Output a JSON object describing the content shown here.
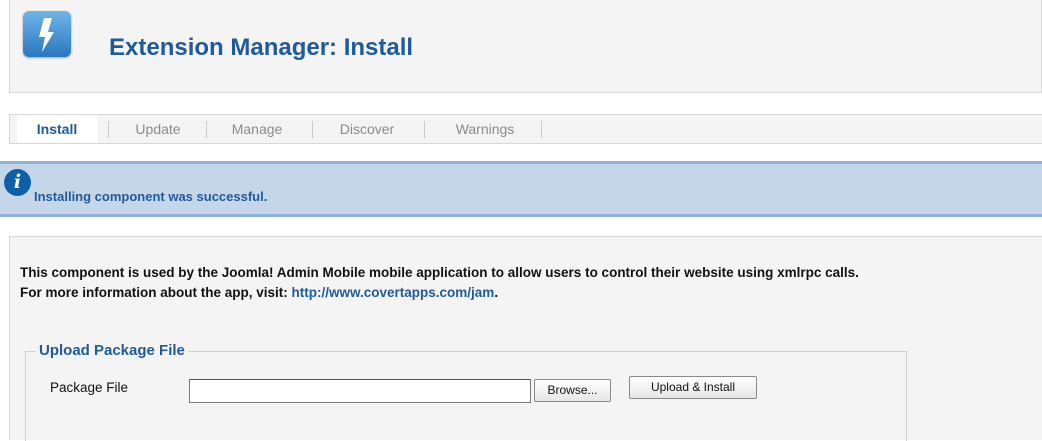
{
  "header": {
    "title": "Extension Manager: Install",
    "icon": "lightning-bolt-icon"
  },
  "tabs": [
    {
      "label": "Install",
      "active": true
    },
    {
      "label": "Update",
      "active": false
    },
    {
      "label": "Manage",
      "active": false
    },
    {
      "label": "Discover",
      "active": false
    },
    {
      "label": "Warnings",
      "active": false
    }
  ],
  "message": {
    "text": "Installing component was successful.",
    "icon": "info-icon"
  },
  "description": {
    "line1": "This component is used by the Joomla! Admin Mobile mobile application to allow users to control their website using xmlrpc calls.",
    "line2_prefix": "For more information about the app, visit: ",
    "link": "http://www.covertapps.com/jam",
    "line2_suffix": "."
  },
  "upload": {
    "legend": "Upload Package File",
    "field_label": "Package File",
    "field_value": "",
    "browse_label": "Browse...",
    "install_label": "Upload & Install"
  }
}
